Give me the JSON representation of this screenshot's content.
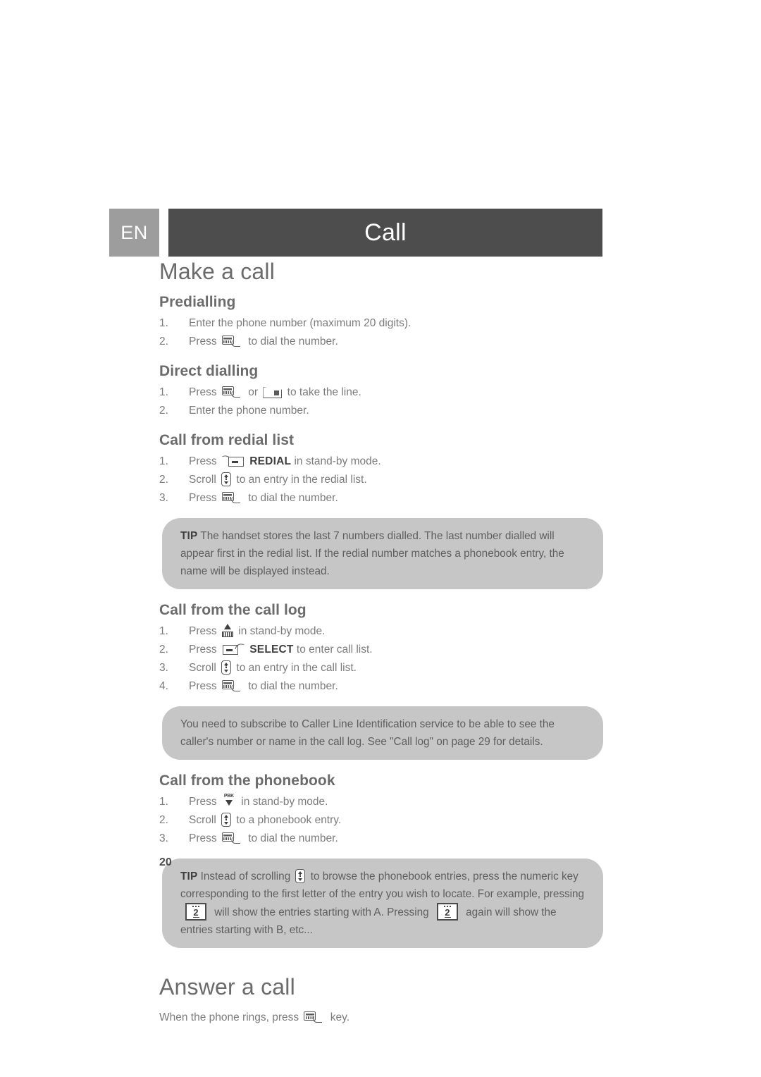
{
  "header": {
    "language_tab": "EN",
    "chapter_title": "Call",
    "tab_color": "#9d9d9d",
    "bar_color": "#4d4d4d"
  },
  "sections": {
    "make_a_call": {
      "title": "Make a call",
      "predialling": {
        "heading": "Predialling",
        "steps": [
          {
            "pre": "Enter the phone number (maximum 20 digits).",
            "post": ""
          },
          {
            "pre": "Press",
            "icon": "talk-key-icon",
            "post": "to dial the number."
          }
        ]
      },
      "direct_dialling": {
        "heading": "Direct dialling",
        "steps": [
          {
            "pre": "Press",
            "icon": "talk-key-icon",
            "mid": "or",
            "icon2": "line-key-icon",
            "post": "to take the line."
          },
          {
            "pre": "Enter the phone number.",
            "post": ""
          }
        ]
      },
      "redial_list": {
        "heading": "Call from redial list",
        "steps": [
          {
            "pre": "Press",
            "icon": "left-softkey-icon",
            "bold": "REDIAL",
            "post": "in stand-by mode."
          },
          {
            "pre": "Scroll",
            "icon": "scroll-key-icon",
            "post": "to an entry in the redial list."
          },
          {
            "pre": "Press",
            "icon": "talk-key-icon",
            "post": "to dial the number."
          }
        ],
        "tip": {
          "label": "TIP",
          "text": "The handset stores the last 7 numbers dialled. The last number dialled will appear first in the redial list. If the redial number matches a phonebook entry, the name will be displayed instead."
        }
      },
      "call_log": {
        "heading": "Call from the call log",
        "steps": [
          {
            "pre": "Press",
            "icon": "call-log-key-icon",
            "post": "in stand-by mode."
          },
          {
            "pre": "Press",
            "icon": "right-softkey-icon",
            "bold": "SELECT",
            "post": "to enter call list."
          },
          {
            "pre": "Scroll",
            "icon": "scroll-key-icon",
            "post": "to an entry in the call list."
          },
          {
            "pre": "Press",
            "icon": "talk-key-icon",
            "post": "to dial the number."
          }
        ],
        "note": {
          "text": "You need to subscribe to Caller Line Identification service to be able to see the caller's number or name in the call log. See \"Call log\" on page 29 for details."
        }
      },
      "phonebook": {
        "heading": "Call from the phonebook",
        "steps": [
          {
            "pre": "Press",
            "icon": "phonebook-key-icon",
            "post": "in stand-by mode."
          },
          {
            "pre": "Scroll",
            "icon": "scroll-key-icon",
            "post": "to a phonebook entry."
          },
          {
            "pre": "Press",
            "icon": "talk-key-icon",
            "post": "to dial the number."
          }
        ],
        "tip": {
          "label": "TIP",
          "part1": "Instead of scrolling",
          "part2": "to browse the phonebook entries, press the numeric key corresponding to the first letter of the entry you wish to locate. For example, pressing",
          "part3": "will show the entries starting with A. Pressing",
          "part4": "again will show the entries starting with B, etc...",
          "key_digit": "2"
        }
      }
    },
    "answer_a_call": {
      "title": "Answer a call",
      "body_pre": "When the phone rings, press",
      "body_icon": "talk-key-icon",
      "body_post": "key."
    }
  },
  "footer": {
    "page_number": "20"
  },
  "colors": {
    "callout_bg": "#c6c6c6",
    "text": "#7b7b7b",
    "heading": "#6b6b6b"
  }
}
